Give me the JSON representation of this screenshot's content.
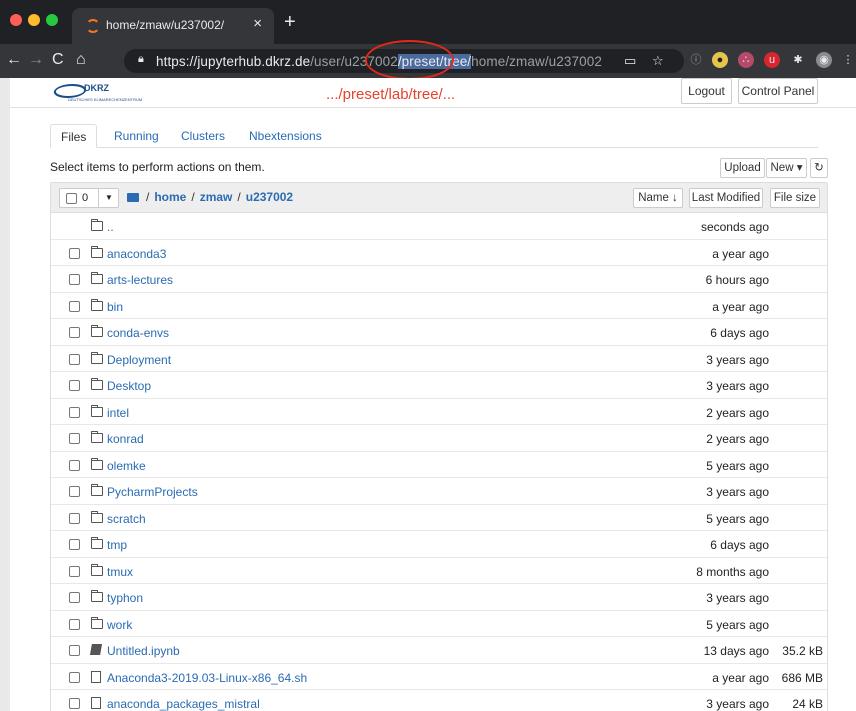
{
  "browser": {
    "tab_title": "home/zmaw/u237002/",
    "url_host": "https://jupyterhub.dkrz.de",
    "url_path_before": "/user/u23700",
    "url_path_hidden": "2",
    "url_selected": "/preset/tree/",
    "url_path_after": "home/zmaw/u237002",
    "close_icon": "×",
    "newtab_icon": "+"
  },
  "header": {
    "logo_text": "DKRZ",
    "logo_subtext": "DEUTSCHES KLIMARECHENZENTRUM",
    "annotation": ".../preset/lab/tree/...",
    "logout_label": "Logout",
    "control_panel_label": "Control Panel"
  },
  "tabs": [
    {
      "label": "Files"
    },
    {
      "label": "Running"
    },
    {
      "label": "Clusters"
    },
    {
      "label": "Nbextensions"
    }
  ],
  "toolbar": {
    "hint": "Select items to perform actions on them.",
    "upload_label": "Upload",
    "new_label": "New ▾",
    "refresh_icon": "↻"
  },
  "list": {
    "selected_count": "0",
    "breadcrumb": [
      "home",
      "zmaw",
      "u237002"
    ],
    "sort_name_label": "Name ↓",
    "sort_modified_label": "Last Modified",
    "sort_size_label": "File size",
    "rows": [
      {
        "name": "..",
        "type": "folder",
        "modified": "seconds ago",
        "size": "",
        "checkbox": false
      },
      {
        "name": "anaconda3",
        "type": "folder",
        "modified": "a year ago",
        "size": "",
        "checkbox": true
      },
      {
        "name": "arts-lectures",
        "type": "folder",
        "modified": "6 hours ago",
        "size": "",
        "checkbox": true
      },
      {
        "name": "bin",
        "type": "folder",
        "modified": "a year ago",
        "size": "",
        "checkbox": true
      },
      {
        "name": "conda-envs",
        "type": "folder",
        "modified": "6 days ago",
        "size": "",
        "checkbox": true
      },
      {
        "name": "Deployment",
        "type": "folder",
        "modified": "3 years ago",
        "size": "",
        "checkbox": true
      },
      {
        "name": "Desktop",
        "type": "folder",
        "modified": "3 years ago",
        "size": "",
        "checkbox": true
      },
      {
        "name": "intel",
        "type": "folder",
        "modified": "2 years ago",
        "size": "",
        "checkbox": true
      },
      {
        "name": "konrad",
        "type": "folder",
        "modified": "2 years ago",
        "size": "",
        "checkbox": true
      },
      {
        "name": "olemke",
        "type": "folder",
        "modified": "5 years ago",
        "size": "",
        "checkbox": true
      },
      {
        "name": "PycharmProjects",
        "type": "folder",
        "modified": "3 years ago",
        "size": "",
        "checkbox": true
      },
      {
        "name": "scratch",
        "type": "folder",
        "modified": "5 years ago",
        "size": "",
        "checkbox": true
      },
      {
        "name": "tmp",
        "type": "folder",
        "modified": "6 days ago",
        "size": "",
        "checkbox": true
      },
      {
        "name": "tmux",
        "type": "folder",
        "modified": "8 months ago",
        "size": "",
        "checkbox": true
      },
      {
        "name": "typhon",
        "type": "folder",
        "modified": "3 years ago",
        "size": "",
        "checkbox": true
      },
      {
        "name": "work",
        "type": "folder",
        "modified": "5 years ago",
        "size": "",
        "checkbox": true
      },
      {
        "name": "Untitled.ipynb",
        "type": "notebook",
        "modified": "13 days ago",
        "size": "35.2 kB",
        "checkbox": true
      },
      {
        "name": "Anaconda3-2019.03-Linux-x86_64.sh",
        "type": "file",
        "modified": "a year ago",
        "size": "686 MB",
        "checkbox": true
      },
      {
        "name": "anaconda_packages_mistral",
        "type": "file",
        "modified": "3 years ago",
        "size": "24 kB",
        "checkbox": true
      }
    ]
  },
  "colors": {
    "link": "#2a6bb2",
    "annotation": "#e02a1b",
    "chrome_dark": "#202124"
  }
}
